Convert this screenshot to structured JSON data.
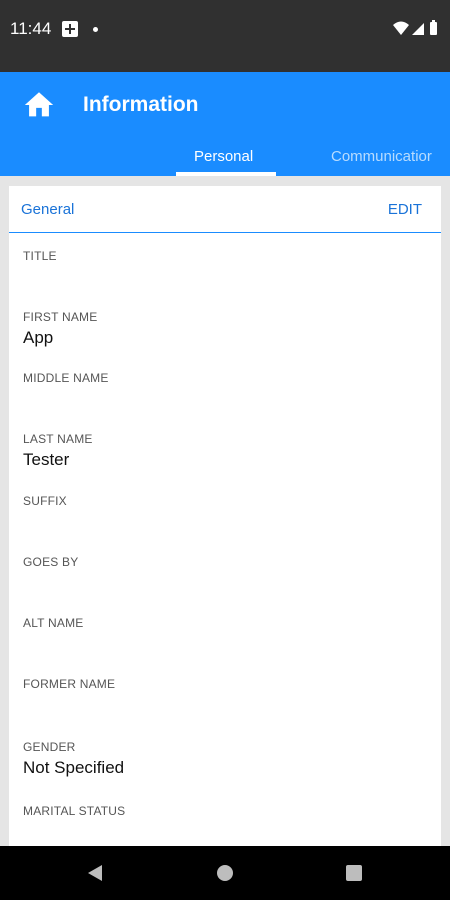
{
  "status_bar": {
    "time": "11:44",
    "icons": [
      "app-notification-icon",
      "dot-icon",
      "wifi-icon",
      "signal-icon",
      "battery-icon"
    ]
  },
  "app_bar": {
    "title": "Information",
    "home_icon": "home-icon",
    "tabs": [
      {
        "label": "Personal",
        "selected": true
      },
      {
        "label": "Communicatior",
        "selected": false
      }
    ],
    "color": "#1a8cff"
  },
  "card": {
    "section_title": "General",
    "edit_label": "EDIT",
    "fields": [
      {
        "label": "TITLE",
        "value": ""
      },
      {
        "label": "FIRST NAME",
        "value": "App"
      },
      {
        "label": "MIDDLE NAME",
        "value": ""
      },
      {
        "label": "LAST NAME",
        "value": "Tester"
      },
      {
        "label": "SUFFIX",
        "value": ""
      },
      {
        "label": "GOES BY",
        "value": ""
      },
      {
        "label": "ALT NAME",
        "value": ""
      },
      {
        "label": "FORMER NAME",
        "value": ""
      },
      {
        "label": "GENDER",
        "value": "Not Specified"
      },
      {
        "label": "MARITAL STATUS",
        "value": ""
      }
    ]
  },
  "nav_bar": {
    "icons": [
      "back-icon",
      "home-circle-icon",
      "recents-icon"
    ]
  }
}
